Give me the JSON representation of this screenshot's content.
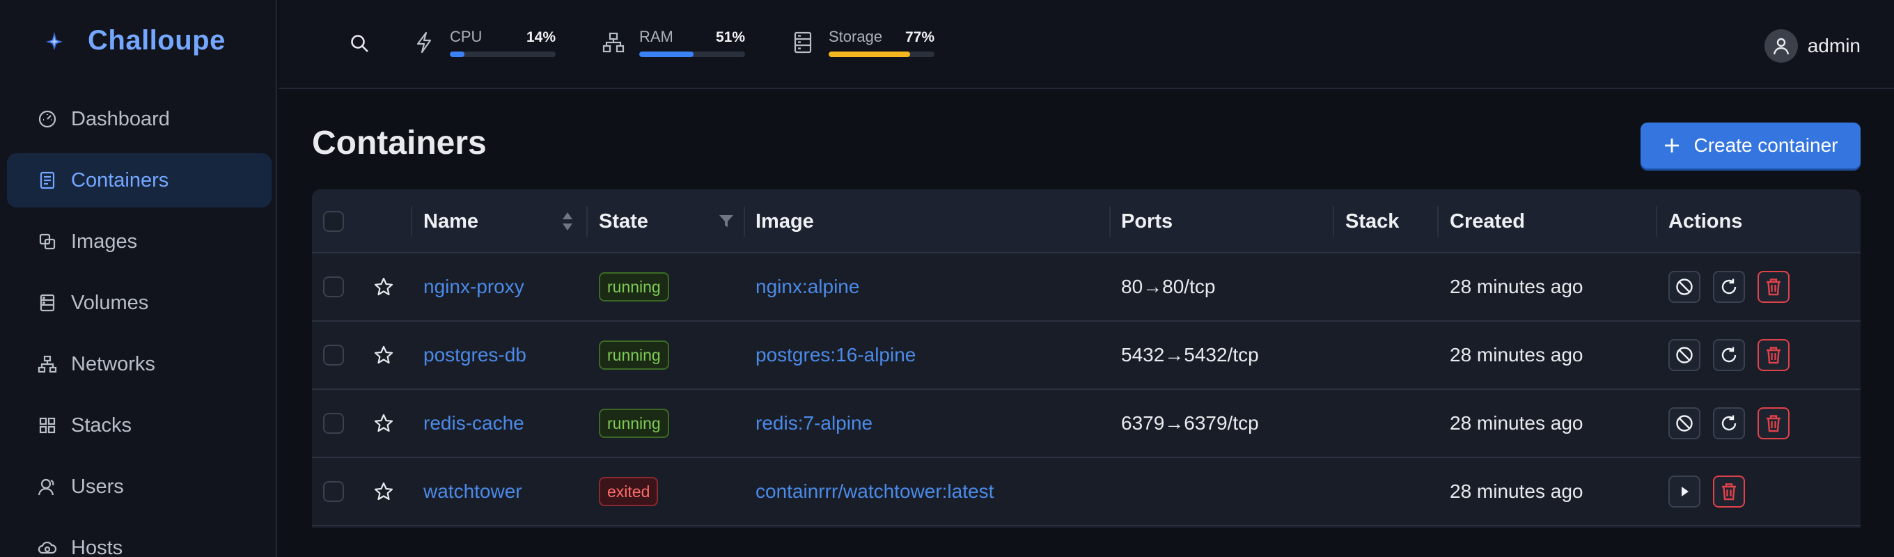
{
  "brand": {
    "name": "Challoupe"
  },
  "sidebar": {
    "items": [
      {
        "label": "Dashboard",
        "icon": "gauge-icon",
        "active": false
      },
      {
        "label": "Containers",
        "icon": "container-icon",
        "active": true
      },
      {
        "label": "Images",
        "icon": "images-icon",
        "active": false
      },
      {
        "label": "Volumes",
        "icon": "volume-icon",
        "active": false
      },
      {
        "label": "Networks",
        "icon": "network-icon",
        "active": false
      },
      {
        "label": "Stacks",
        "icon": "stacks-icon",
        "active": false
      },
      {
        "label": "Users",
        "icon": "users-icon",
        "active": false
      },
      {
        "label": "Hosts",
        "icon": "cloud-icon",
        "active": false
      }
    ]
  },
  "topbar": {
    "metrics": [
      {
        "label": "CPU",
        "value": "14%",
        "fraction": 0.14,
        "color": "#3b82f6",
        "icon": "lightning-icon"
      },
      {
        "label": "RAM",
        "value": "51%",
        "fraction": 0.51,
        "color": "#3b82f6",
        "icon": "ram-icon"
      },
      {
        "label": "Storage",
        "value": "77%",
        "fraction": 0.77,
        "color": "#f5b71f",
        "icon": "storage-icon"
      }
    ],
    "user": {
      "name": "admin"
    }
  },
  "page": {
    "title": "Containers",
    "create_label": "Create container"
  },
  "table": {
    "columns": {
      "name": "Name",
      "state": "State",
      "image": "Image",
      "ports": "Ports",
      "stack": "Stack",
      "created": "Created",
      "actions": "Actions"
    },
    "rows": [
      {
        "name": "nginx-proxy",
        "state": "running",
        "image": "nginx:alpine",
        "ports": "80→80/tcp",
        "stack": "",
        "created": "28 minutes ago"
      },
      {
        "name": "postgres-db",
        "state": "running",
        "image": "postgres:16-alpine",
        "ports": "5432→5432/tcp",
        "stack": "",
        "created": "28 minutes ago"
      },
      {
        "name": "redis-cache",
        "state": "running",
        "image": "redis:7-alpine",
        "ports": "6379→6379/tcp",
        "stack": "",
        "created": "28 minutes ago"
      },
      {
        "name": "watchtower",
        "state": "exited",
        "image": "containrrr/watchtower:latest",
        "ports": "",
        "stack": "",
        "created": "28 minutes ago"
      }
    ]
  },
  "colors": {
    "accent": "#3475e0",
    "link": "#4b8ae8",
    "running": "#7ec955",
    "exited": "#ff6b6b",
    "danger": "#e0424a"
  }
}
